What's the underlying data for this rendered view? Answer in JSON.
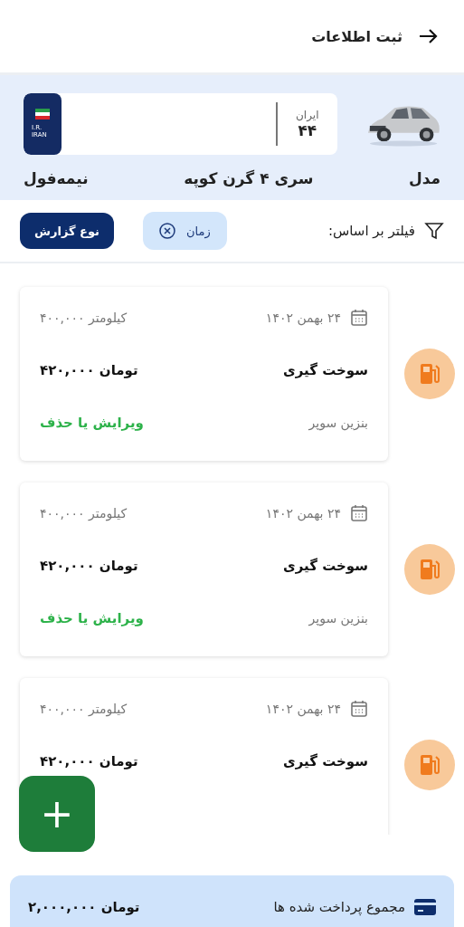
{
  "header": {
    "title": "ثبت اطلاعات"
  },
  "vehicle": {
    "plate": {
      "region_label": "ایران",
      "region_number": "۴۴",
      "country": "I.R. IRAN"
    },
    "specs": [
      "مدل",
      "سری ۴ گرن کوپه",
      "نیمه‌فول"
    ]
  },
  "filter": {
    "label": "فیلتر بر اساس:",
    "chips": [
      {
        "label": "زمان",
        "removable": true
      }
    ],
    "report_button": "نوع گزارش"
  },
  "records": [
    {
      "date": "۲۴ بهمن ۱۴۰۲",
      "odometer": "۴۰۰,۰۰۰ کیلومتر",
      "title": "سوخت گیری",
      "amount": "۴۲۰,۰۰۰ تومان",
      "detail": "بنزین سوپر",
      "action": "ویرایش یا حذف"
    },
    {
      "date": "۲۴ بهمن ۱۴۰۲",
      "odometer": "۴۰۰,۰۰۰ کیلومتر",
      "title": "سوخت گیری",
      "amount": "۴۲۰,۰۰۰ تومان",
      "detail": "بنزین سوپر",
      "action": "ویرایش یا حذف"
    },
    {
      "date": "۲۴ بهمن ۱۴۰۲",
      "odometer": "۴۰۰,۰۰۰ کیلومتر",
      "title": "سوخت گیری",
      "amount": "۴۲۰,۰۰۰ تومان"
    }
  ],
  "add_button": "+",
  "total": {
    "label": "مجموع پرداخت شده ها",
    "amount": "۲,۰۰۰,۰۰۰ تومان"
  }
}
